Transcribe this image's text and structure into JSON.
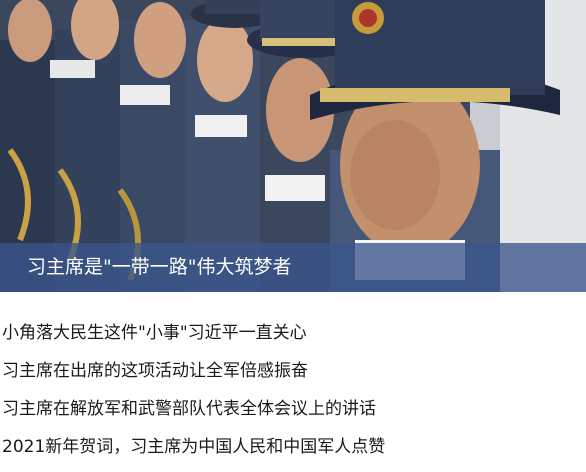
{
  "featured": {
    "caption": "习主席是\"一带一路\"伟大筑梦者",
    "image_description_icon": "honor-guard-soldiers-photo"
  },
  "news": [
    {
      "title": "小角落大民生这件\"小事\"习近平一直关心"
    },
    {
      "title": "习主席在出席的这项活动让全军倍感振奋"
    },
    {
      "title": "习主席在解放军和武警部队代表全体会议上的讲话"
    },
    {
      "title": "2021新年贺词，习主席为中国人民和中国军人点赞"
    }
  ],
  "colors": {
    "caption_bar": "#3a568c",
    "caption_text": "#ffffff",
    "list_text": "#1a1a1a",
    "background": "#ffffff"
  }
}
